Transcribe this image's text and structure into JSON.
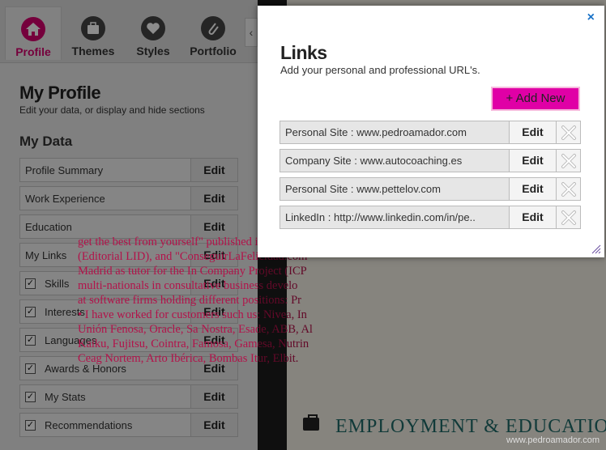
{
  "tabs": [
    {
      "label": "Profile",
      "icon": "home-icon"
    },
    {
      "label": "Themes",
      "icon": "briefcase-icon"
    },
    {
      "label": "Styles",
      "icon": "heart-icon"
    },
    {
      "label": "Portfolio",
      "icon": "paperclip-icon"
    }
  ],
  "profile": {
    "title": "My Profile",
    "subtitle": "Edit your data, or display and hide sections",
    "my_data_title": "My Data",
    "edit_label": "Edit",
    "rows": [
      {
        "label": "Profile Summary",
        "checkbox": false
      },
      {
        "label": "Work Experience",
        "checkbox": false
      },
      {
        "label": "Education",
        "checkbox": false
      },
      {
        "label": "My Links",
        "checkbox": false
      },
      {
        "label": "Skills",
        "checkbox": true,
        "checked": true
      },
      {
        "label": "Interests",
        "checkbox": true,
        "checked": true
      },
      {
        "label": "Languages",
        "checkbox": true,
        "checked": true
      },
      {
        "label": "Awards & Honors",
        "checkbox": true,
        "checked": true
      },
      {
        "label": "My Stats",
        "checkbox": true,
        "checked": true
      },
      {
        "label": "Recommendations",
        "checkbox": true,
        "checked": true
      }
    ]
  },
  "modal": {
    "close": "×",
    "title": "Links",
    "subtitle": "Add your personal and professional URL's.",
    "add_button": "+ Add New",
    "edit_label": "Edit",
    "links": [
      "Personal Site : www.pedroamador.com",
      "Company Site : www.autocoaching.es",
      "Personal Site : www.pettelov.com",
      "LinkedIn : http://www.linkedin.com/in/pe.."
    ]
  },
  "resume": {
    "lines": [
      "get the best from yourself\" published in seven te",
      "(Editorial LID), and \"ConseguirLaFelicidad.com\"",
      "Madrid as tutor for the In Company Project (ICP",
      "multi-nationals in consultative business develo",
      "at software firms holding different positions: Pr",
      "• I have worked for customers such us: Nivea, In",
      "Unión Fenosa, Oracle, Sa Nostra, Esade, ABB, Al",
      "Kaiku, Fujitsu, Cointra, Famosa, Gamesa, Nutrin",
      "Ceag Nortem, Arto Ibérica, Bombas Itur, Elbit."
    ],
    "section_title": "EMPLOYMENT & EDUCATIO"
  },
  "watermark": "www.pedroamador.com",
  "colors": {
    "accent": "#d6006d",
    "add_button": "#e000a6",
    "resume_text": "#b3124a",
    "section_title": "#1f6b69",
    "close": "#1a73c8"
  }
}
